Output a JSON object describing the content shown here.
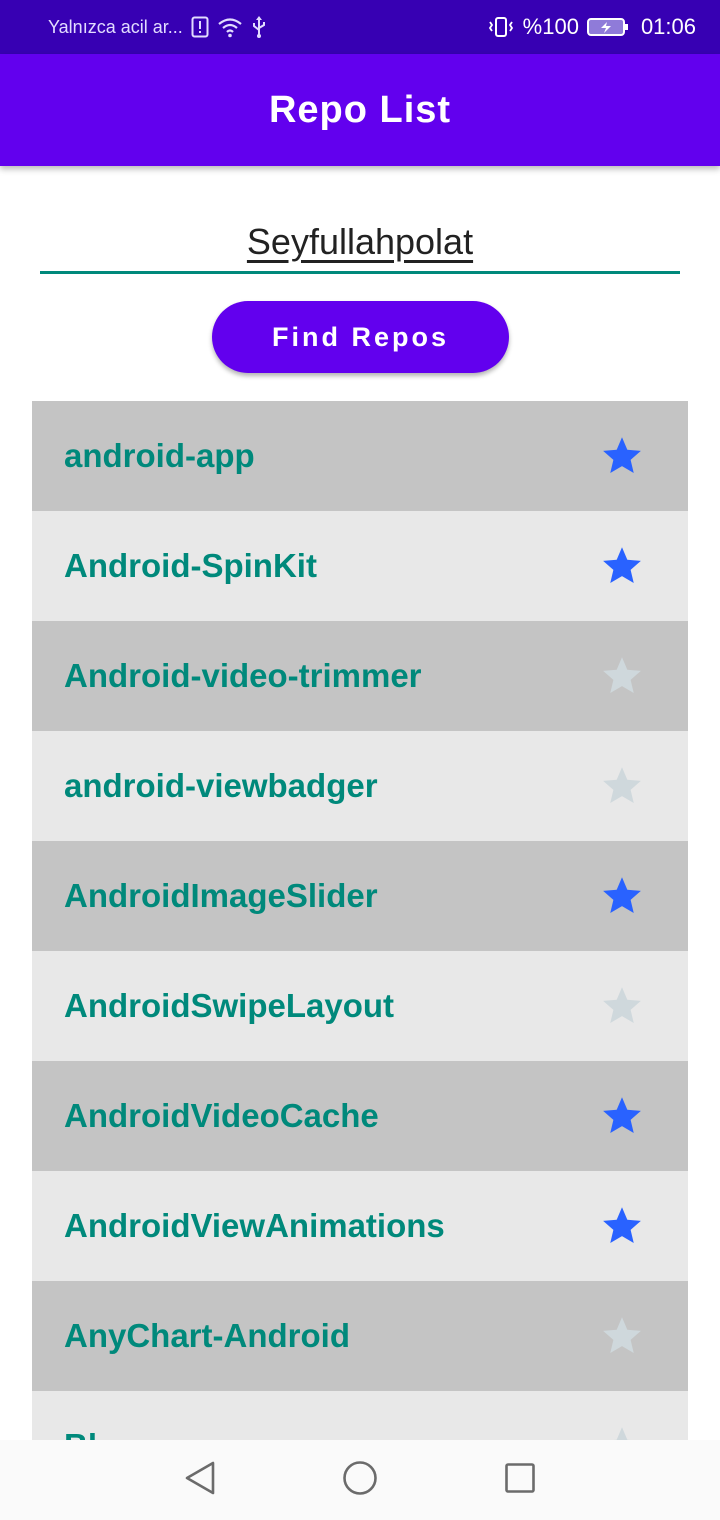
{
  "status_bar": {
    "carrier_text": "Yalnızca acil ar...",
    "battery_percent": "%100",
    "time": "01:06",
    "icons": [
      "alert-icon",
      "wifi-icon",
      "usb-icon",
      "vibrate-icon",
      "battery-charging-icon"
    ]
  },
  "app_bar": {
    "title": "Repo List"
  },
  "search": {
    "value": "Seyfullahpolat"
  },
  "find_button": {
    "label": "Find Repos"
  },
  "repos": [
    {
      "name": "android-app",
      "starred": true
    },
    {
      "name": "Android-SpinKit",
      "starred": true
    },
    {
      "name": "Android-video-trimmer",
      "starred": false
    },
    {
      "name": "android-viewbadger",
      "starred": false
    },
    {
      "name": "AndroidImageSlider",
      "starred": true
    },
    {
      "name": "AndroidSwipeLayout",
      "starred": false
    },
    {
      "name": "AndroidVideoCache",
      "starred": true
    },
    {
      "name": "AndroidViewAnimations",
      "starred": true
    },
    {
      "name": "AnyChart-Android",
      "starred": false
    },
    {
      "name": "Bl...",
      "starred": false
    }
  ],
  "nav_bar": {
    "icons": [
      "back-icon",
      "home-icon",
      "recents-icon"
    ]
  },
  "colors": {
    "status_bar": "#3700b3",
    "primary": "#6200ee",
    "accent_teal": "#00897b",
    "star_on": "#2962ff",
    "star_off": "#cfd8dc",
    "row_dark": "#c4c4c4",
    "row_light": "#e8e8e8"
  }
}
